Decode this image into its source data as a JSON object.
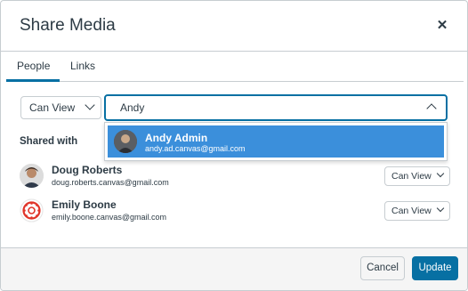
{
  "dialog": {
    "title": "Share Media",
    "close_icon": "close-icon"
  },
  "tabs": [
    {
      "label": "People",
      "active": true
    },
    {
      "label": "Links",
      "active": false
    }
  ],
  "add_form": {
    "permission": "Can View",
    "search_value": "Andy"
  },
  "suggestions": [
    {
      "name": "Andy Admin",
      "email": "andy.ad.canvas@gmail.com",
      "highlighted": true
    }
  ],
  "shared": {
    "heading": "Shared with",
    "people": [
      {
        "name": "Doug Roberts",
        "email": "doug.roberts.canvas@gmail.com",
        "permission": "Can View",
        "avatar": "photo"
      },
      {
        "name": "Emily Boone",
        "email": "emily.boone.canvas@gmail.com",
        "permission": "Can View",
        "avatar": "logo"
      }
    ]
  },
  "footer": {
    "cancel_label": "Cancel",
    "update_label": "Update"
  },
  "colors": {
    "primary": "#0770a3",
    "highlight": "#3b8fdb",
    "border": "#c7cdd1",
    "text": "#2d3b45",
    "footer_bg": "#f5f5f5"
  }
}
